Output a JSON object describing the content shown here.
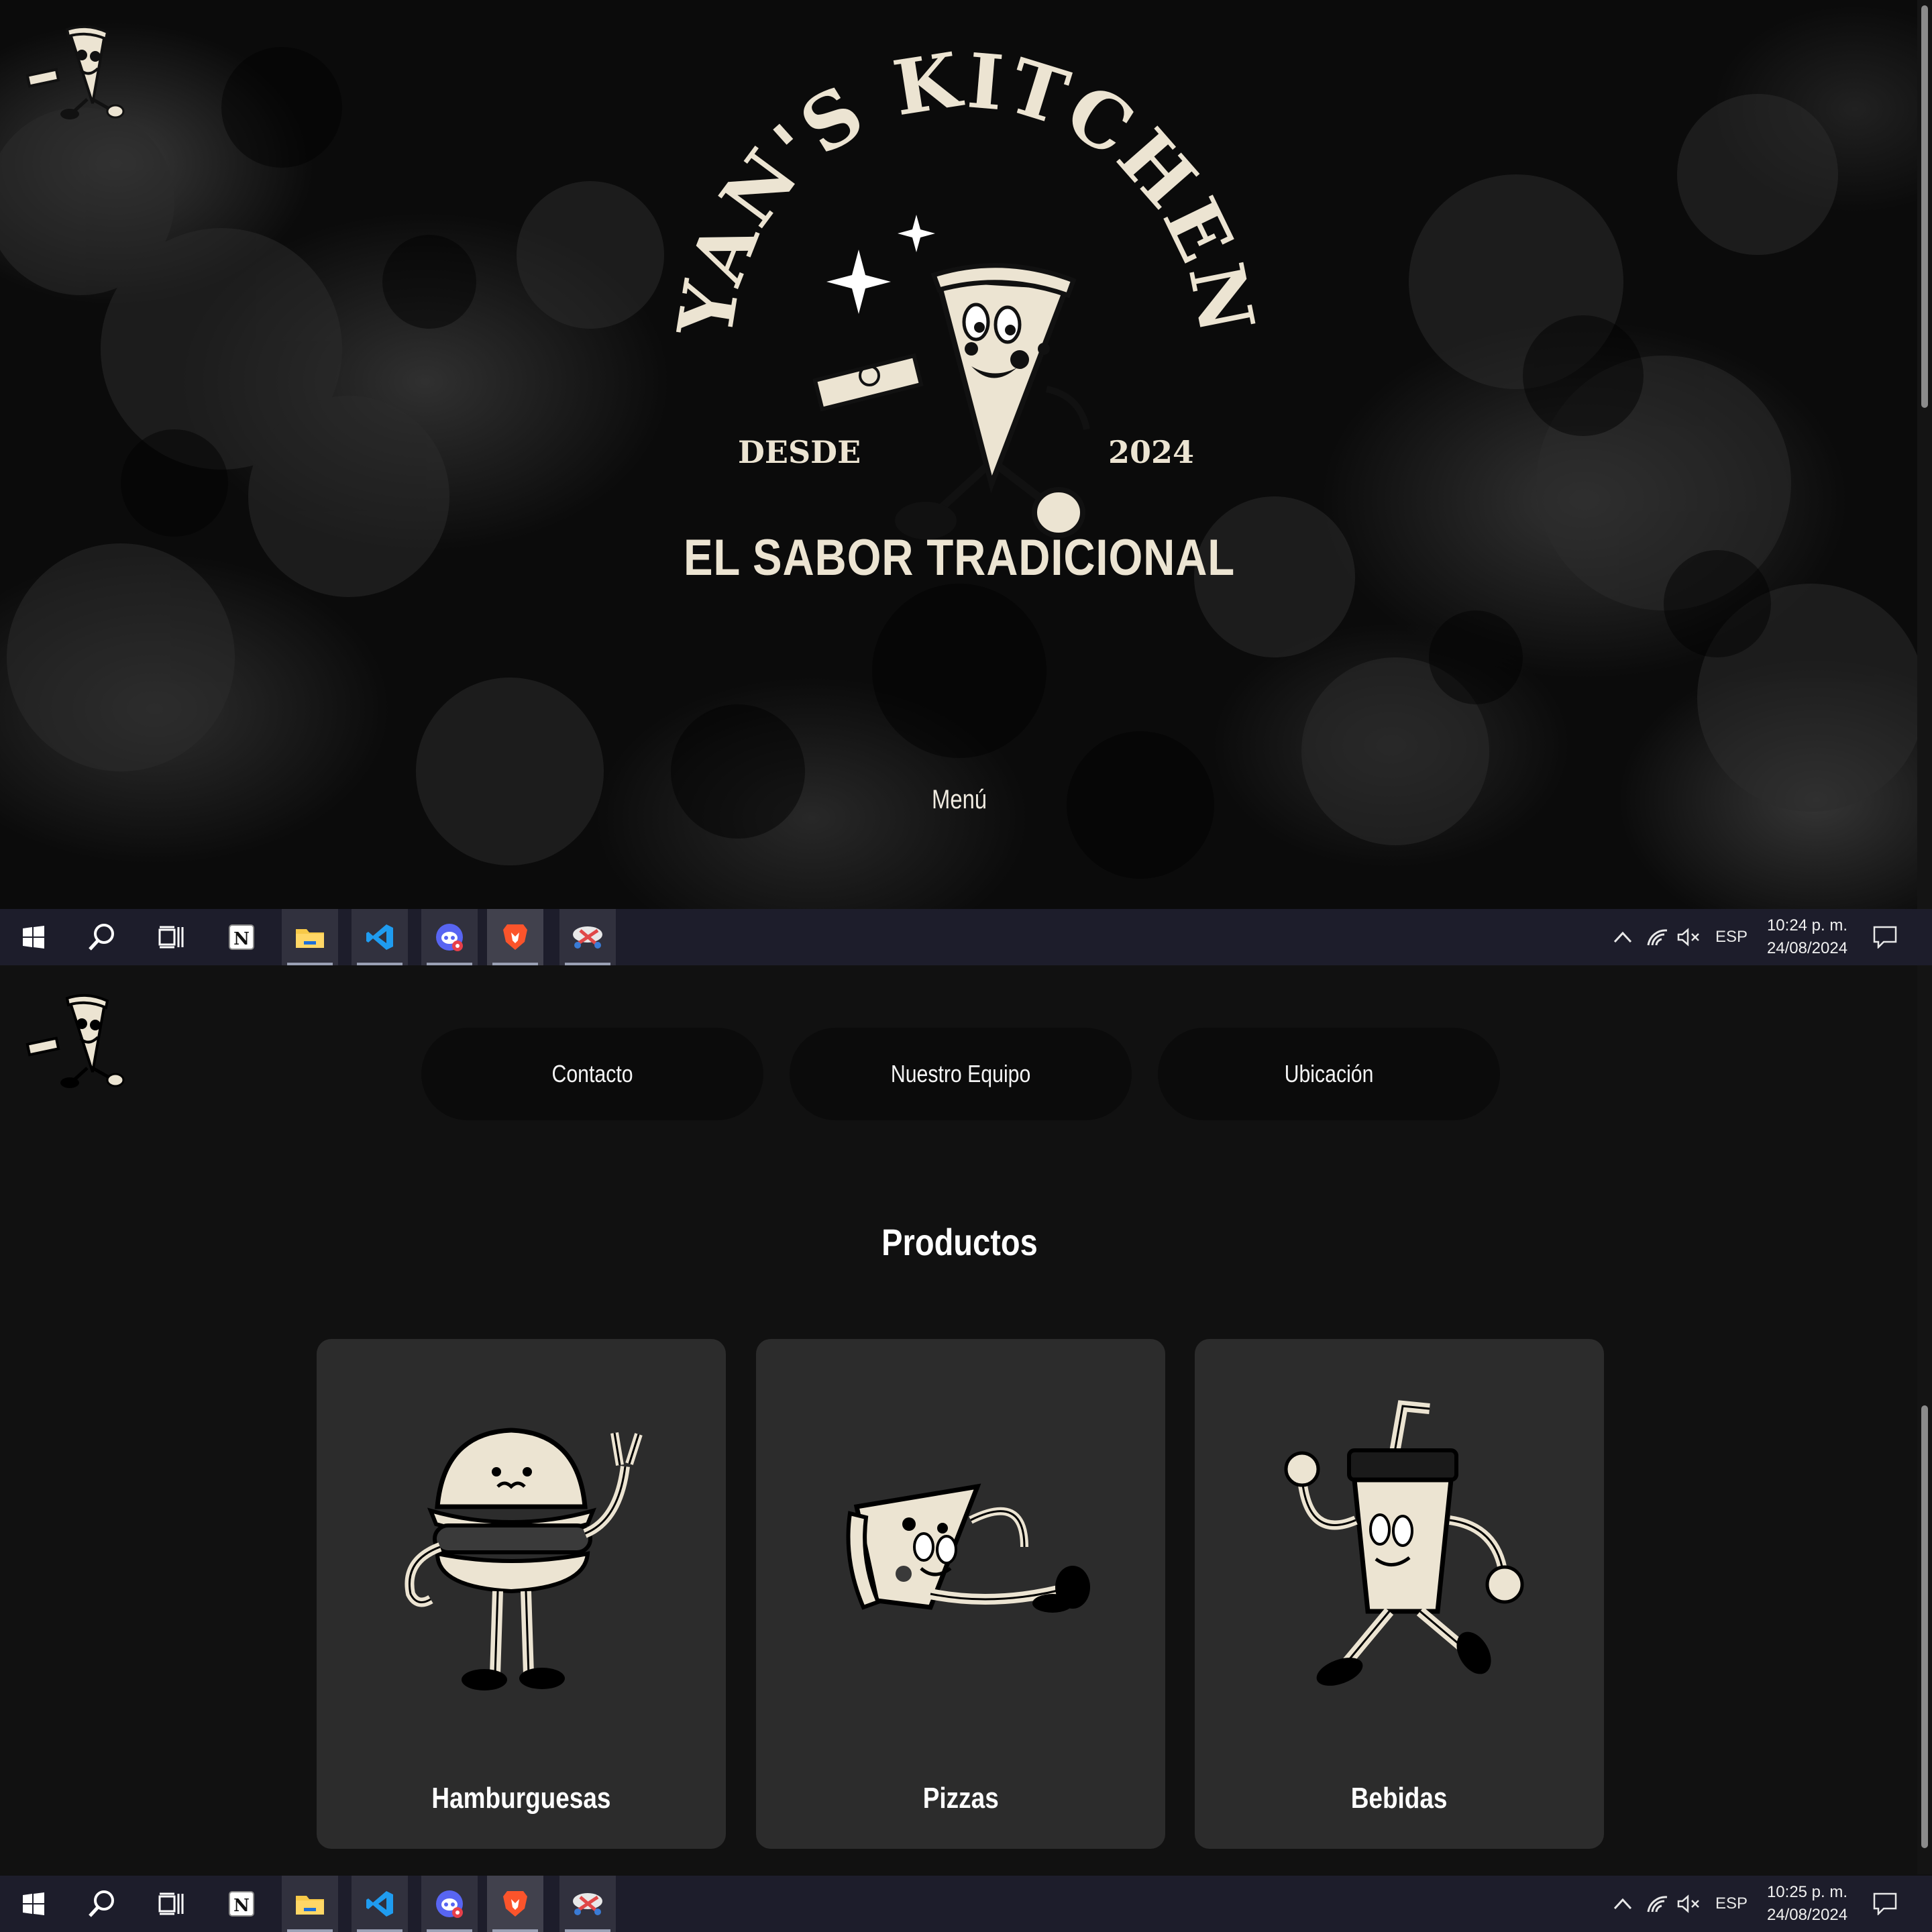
{
  "colors": {
    "cream": "#ece4d2",
    "page_bg": "#111111",
    "card_bg": "#2c2c2c",
    "pill_bg": "#0b0b0b",
    "taskbar_bg": "#1d1d2b"
  },
  "hero": {
    "brand_arc": "YAN'S KITCHEN",
    "since_label": "DESDE",
    "since_year": "2024",
    "tagline": "EL SABOR TRADICIONAL",
    "menu_link": "Menú",
    "mascot_icon": "pizza-slice-mascot-icon"
  },
  "nav": {
    "contact": "Contacto",
    "team": "Nuestro Equipo",
    "location": "Ubicación"
  },
  "products": {
    "title": "Productos",
    "items": [
      {
        "label": "Hamburguesas",
        "icon": "burger-mascot-icon"
      },
      {
        "label": "Pizzas",
        "icon": "pizza-mascot-icon"
      },
      {
        "label": "Bebidas",
        "icon": "drink-cup-mascot-icon"
      }
    ]
  },
  "taskbars": [
    {
      "time": "10:24 p. m.",
      "date": "24/08/2024",
      "language": "ESP"
    },
    {
      "time": "10:25 p. m.",
      "date": "24/08/2024",
      "language": "ESP"
    }
  ],
  "taskbar_apps": [
    {
      "name": "start",
      "icon": "windows-icon"
    },
    {
      "name": "search",
      "icon": "search-icon"
    },
    {
      "name": "task-view",
      "icon": "task-view-icon"
    },
    {
      "name": "notion",
      "icon": "notion-icon"
    },
    {
      "name": "file-explorer",
      "icon": "folder-icon"
    },
    {
      "name": "vscode",
      "icon": "vscode-icon"
    },
    {
      "name": "discord",
      "icon": "discord-icon"
    },
    {
      "name": "brave",
      "icon": "brave-lion-icon"
    },
    {
      "name": "snipping-tool",
      "icon": "snipping-tool-icon"
    }
  ]
}
